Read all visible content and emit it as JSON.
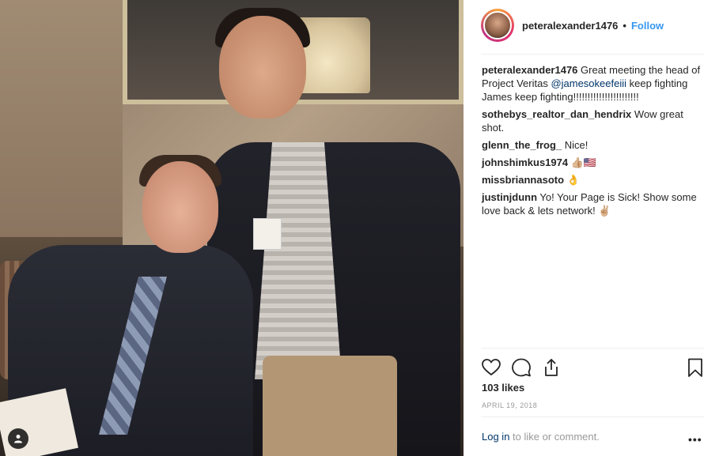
{
  "header": {
    "username": "peteralexander1476",
    "separator": "•",
    "follow_label": "Follow"
  },
  "comments": [
    {
      "user": "peteralexander1476",
      "text_before": " Great meeting the head of Project Veritas ",
      "mention": "@jamesokeefeiii",
      "text_after": " keep fighting James keep fighting!!!!!!!!!!!!!!!!!!!!!!!"
    },
    {
      "user": "sothebys_realtor_dan_hendrix",
      "text": " Wow great shot."
    },
    {
      "user": "glenn_the_frog_",
      "text": " Nice!"
    },
    {
      "user": "johnshimkus1974",
      "text": " 👍🏼🇺🇸"
    },
    {
      "user": "missbriannasoto",
      "text": " 👌"
    },
    {
      "user": "justinjdunn",
      "text": " Yo! Your Page is Sick! Show some love back & lets network! ✌🏼"
    }
  ],
  "actions": {
    "like_icon": "heart-icon",
    "comment_icon": "comment-icon",
    "share_icon": "share-icon",
    "save_icon": "bookmark-icon"
  },
  "likes": "103 likes",
  "date": "APRIL 19, 2018",
  "footer": {
    "login_label": "Log in",
    "login_suffix": " to like or comment.",
    "more_label": "•••"
  },
  "colors": {
    "link_blue": "#3897f0",
    "mention_blue": "#003569",
    "muted": "#999999",
    "text": "#262626"
  }
}
